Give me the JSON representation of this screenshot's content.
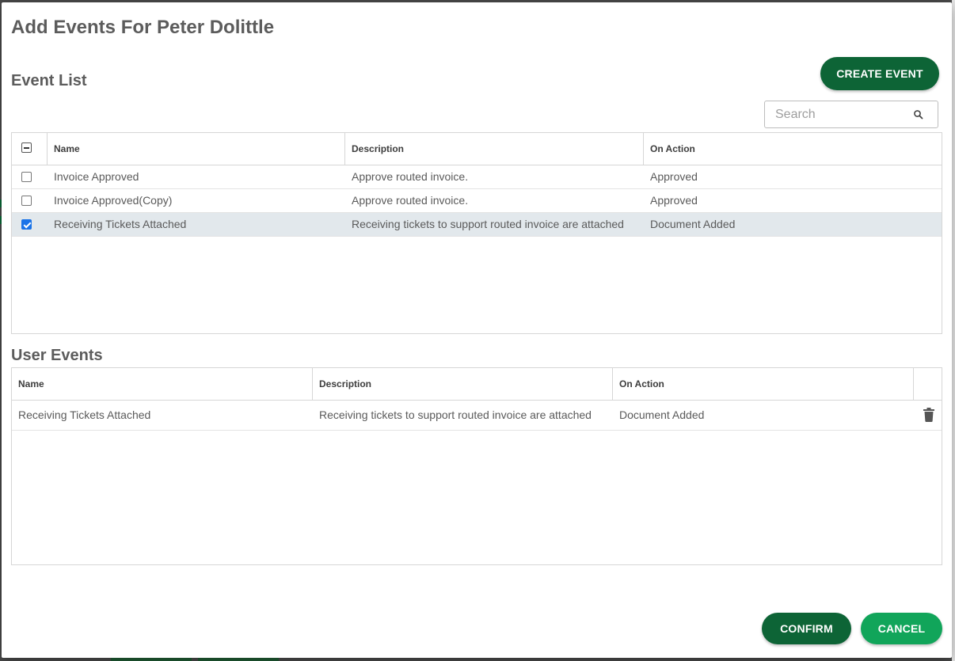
{
  "dialog": {
    "title": "Add Events For Peter Dolittle"
  },
  "event_list": {
    "title": "Event List",
    "create_button_label": "CREATE EVENT",
    "search": {
      "placeholder": "Search",
      "value": ""
    },
    "columns": {
      "name": "Name",
      "description": "Description",
      "on_action": "On Action"
    },
    "select_all_state": "indeterminate",
    "rows": [
      {
        "name": "Invoice Approved",
        "description": "Approve routed invoice.",
        "on_action": "Approved",
        "checked": false
      },
      {
        "name": "Invoice Approved(Copy)",
        "description": "Approve routed invoice.",
        "on_action": "Approved",
        "checked": false
      },
      {
        "name": "Receiving Tickets Attached",
        "description": "Receiving tickets to support routed invoice are attached",
        "on_action": "Document Added",
        "checked": true
      }
    ]
  },
  "user_events": {
    "title": "User Events",
    "columns": {
      "name": "Name",
      "description": "Description",
      "on_action": "On Action"
    },
    "rows": [
      {
        "name": "Receiving Tickets Attached",
        "description": "Receiving tickets to support routed invoice are attached",
        "on_action": "Document Added"
      }
    ]
  },
  "footer": {
    "confirm_label": "CONFIRM",
    "cancel_label": "CANCEL"
  },
  "icons": {
    "search": "search-icon",
    "delete": "trash-icon"
  },
  "colors": {
    "primary_dark": "#0d6436",
    "primary_light": "#11a55a",
    "checkbox_checked": "#1a73e8",
    "selected_row": "#e2e8ec"
  }
}
